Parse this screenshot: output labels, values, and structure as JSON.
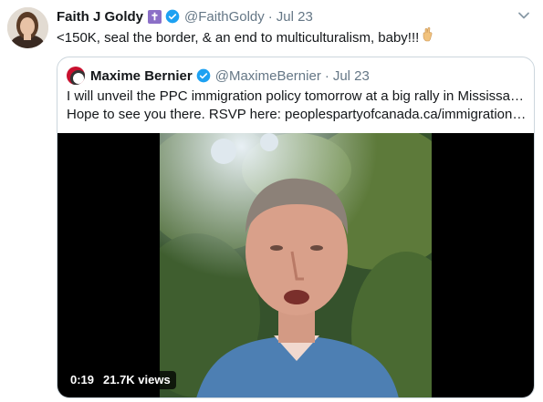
{
  "tweet": {
    "author_name": "Faith J Goldy",
    "handle": "@FaithGoldy",
    "separator": "·",
    "timestamp": "Jul 23",
    "text": "<150K, seal the border, & an end to multiculturalism, baby!!!",
    "badge_glyph": "✝",
    "icons": {
      "avatar": "profile-photo",
      "badge": "latin-cross-emoji",
      "verified": "verified-checkmark",
      "menu": "chevron-down",
      "emoji": "crossed-fingers-emoji"
    }
  },
  "quoted": {
    "author_name": "Maxime Bernier",
    "handle": "@MaximeBernier",
    "separator": "·",
    "timestamp": "Jul 23",
    "text_line1": "I will unveil the PPC immigration policy tomorrow at a big rally in Mississauga.",
    "text_line2": "Hope to see you there. RSVP here: peoplespartyofcanada.ca/immigration_ra...",
    "video": {
      "duration": "0:19",
      "views": "21.7K views"
    }
  },
  "colors": {
    "verified": "#1da1f2",
    "secondary_text": "#657786",
    "border": "#ccd6dd",
    "cross_badge": "#8b6fc7"
  }
}
